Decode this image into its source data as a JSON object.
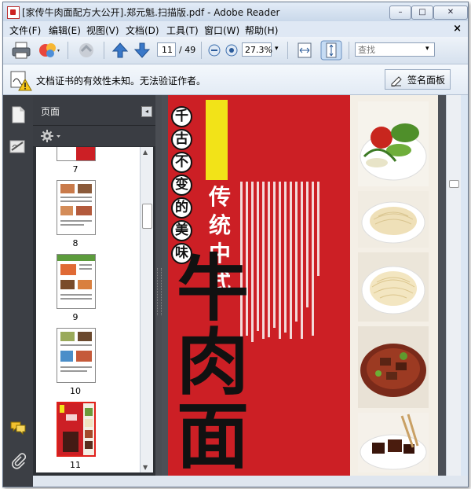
{
  "window": {
    "title": "[家传牛肉面配方大公开].郑元魁.扫描版.pdf - Adobe Reader"
  },
  "window_controls": {
    "minimize": "–",
    "restore": "□",
    "close": "✕"
  },
  "menu": [
    {
      "label": "文件(F)"
    },
    {
      "label": "编辑(E)"
    },
    {
      "label": "视图(V)"
    },
    {
      "label": "文档(D)"
    },
    {
      "label": "工具(T)"
    },
    {
      "label": "窗口(W)"
    },
    {
      "label": "帮助(H)"
    }
  ],
  "menu_close": "×",
  "toolbar": {
    "page_current": "11",
    "page_total": "/ 49",
    "zoom": "27.3%",
    "search_placeholder": "查找"
  },
  "infobar": {
    "message": "文档证书的有效性未知。无法验证作者。",
    "sign_panel_label": "签名面板"
  },
  "nav_panel": {
    "title": "页面",
    "collapse": "◂",
    "thumbnails": [
      {
        "page": "7",
        "selected": false
      },
      {
        "page": "8",
        "selected": false
      },
      {
        "page": "9",
        "selected": false
      },
      {
        "page": "10",
        "selected": false
      },
      {
        "page": "11",
        "selected": true
      }
    ]
  },
  "document": {
    "vertical_title": [
      "千",
      "古",
      "不",
      "变",
      "的",
      "美",
      "味"
    ],
    "heading": [
      "传",
      "统",
      "中",
      "式"
    ],
    "calligraphy": [
      "牛",
      "肉",
      "面"
    ]
  },
  "colors": {
    "page_red": "#cc1f25",
    "accent_yellow": "#f2e318",
    "title_blue": "#dfe8f4",
    "panel_dark": "#2d3035"
  }
}
